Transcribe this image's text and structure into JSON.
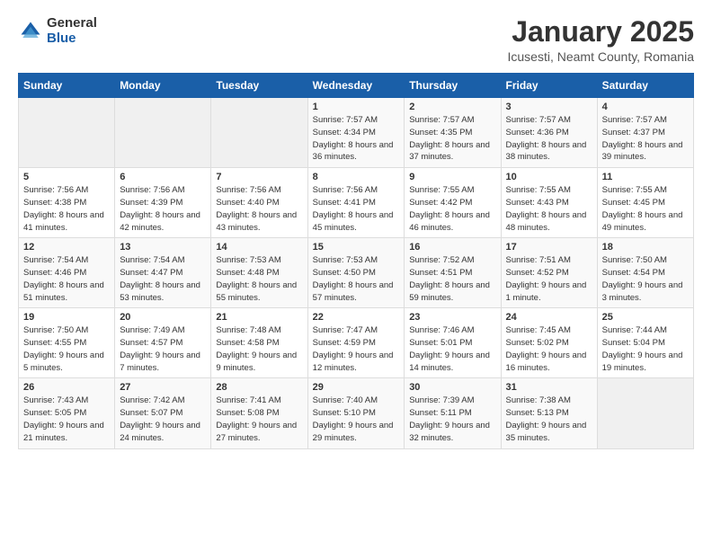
{
  "logo": {
    "general": "General",
    "blue": "Blue"
  },
  "title": "January 2025",
  "location": "Icusesti, Neamt County, Romania",
  "weekdays": [
    "Sunday",
    "Monday",
    "Tuesday",
    "Wednesday",
    "Thursday",
    "Friday",
    "Saturday"
  ],
  "weeks": [
    [
      {
        "day": "",
        "info": ""
      },
      {
        "day": "",
        "info": ""
      },
      {
        "day": "",
        "info": ""
      },
      {
        "day": "1",
        "info": "Sunrise: 7:57 AM\nSunset: 4:34 PM\nDaylight: 8 hours and 36 minutes."
      },
      {
        "day": "2",
        "info": "Sunrise: 7:57 AM\nSunset: 4:35 PM\nDaylight: 8 hours and 37 minutes."
      },
      {
        "day": "3",
        "info": "Sunrise: 7:57 AM\nSunset: 4:36 PM\nDaylight: 8 hours and 38 minutes."
      },
      {
        "day": "4",
        "info": "Sunrise: 7:57 AM\nSunset: 4:37 PM\nDaylight: 8 hours and 39 minutes."
      }
    ],
    [
      {
        "day": "5",
        "info": "Sunrise: 7:56 AM\nSunset: 4:38 PM\nDaylight: 8 hours and 41 minutes."
      },
      {
        "day": "6",
        "info": "Sunrise: 7:56 AM\nSunset: 4:39 PM\nDaylight: 8 hours and 42 minutes."
      },
      {
        "day": "7",
        "info": "Sunrise: 7:56 AM\nSunset: 4:40 PM\nDaylight: 8 hours and 43 minutes."
      },
      {
        "day": "8",
        "info": "Sunrise: 7:56 AM\nSunset: 4:41 PM\nDaylight: 8 hours and 45 minutes."
      },
      {
        "day": "9",
        "info": "Sunrise: 7:55 AM\nSunset: 4:42 PM\nDaylight: 8 hours and 46 minutes."
      },
      {
        "day": "10",
        "info": "Sunrise: 7:55 AM\nSunset: 4:43 PM\nDaylight: 8 hours and 48 minutes."
      },
      {
        "day": "11",
        "info": "Sunrise: 7:55 AM\nSunset: 4:45 PM\nDaylight: 8 hours and 49 minutes."
      }
    ],
    [
      {
        "day": "12",
        "info": "Sunrise: 7:54 AM\nSunset: 4:46 PM\nDaylight: 8 hours and 51 minutes."
      },
      {
        "day": "13",
        "info": "Sunrise: 7:54 AM\nSunset: 4:47 PM\nDaylight: 8 hours and 53 minutes."
      },
      {
        "day": "14",
        "info": "Sunrise: 7:53 AM\nSunset: 4:48 PM\nDaylight: 8 hours and 55 minutes."
      },
      {
        "day": "15",
        "info": "Sunrise: 7:53 AM\nSunset: 4:50 PM\nDaylight: 8 hours and 57 minutes."
      },
      {
        "day": "16",
        "info": "Sunrise: 7:52 AM\nSunset: 4:51 PM\nDaylight: 8 hours and 59 minutes."
      },
      {
        "day": "17",
        "info": "Sunrise: 7:51 AM\nSunset: 4:52 PM\nDaylight: 9 hours and 1 minute."
      },
      {
        "day": "18",
        "info": "Sunrise: 7:50 AM\nSunset: 4:54 PM\nDaylight: 9 hours and 3 minutes."
      }
    ],
    [
      {
        "day": "19",
        "info": "Sunrise: 7:50 AM\nSunset: 4:55 PM\nDaylight: 9 hours and 5 minutes."
      },
      {
        "day": "20",
        "info": "Sunrise: 7:49 AM\nSunset: 4:57 PM\nDaylight: 9 hours and 7 minutes."
      },
      {
        "day": "21",
        "info": "Sunrise: 7:48 AM\nSunset: 4:58 PM\nDaylight: 9 hours and 9 minutes."
      },
      {
        "day": "22",
        "info": "Sunrise: 7:47 AM\nSunset: 4:59 PM\nDaylight: 9 hours and 12 minutes."
      },
      {
        "day": "23",
        "info": "Sunrise: 7:46 AM\nSunset: 5:01 PM\nDaylight: 9 hours and 14 minutes."
      },
      {
        "day": "24",
        "info": "Sunrise: 7:45 AM\nSunset: 5:02 PM\nDaylight: 9 hours and 16 minutes."
      },
      {
        "day": "25",
        "info": "Sunrise: 7:44 AM\nSunset: 5:04 PM\nDaylight: 9 hours and 19 minutes."
      }
    ],
    [
      {
        "day": "26",
        "info": "Sunrise: 7:43 AM\nSunset: 5:05 PM\nDaylight: 9 hours and 21 minutes."
      },
      {
        "day": "27",
        "info": "Sunrise: 7:42 AM\nSunset: 5:07 PM\nDaylight: 9 hours and 24 minutes."
      },
      {
        "day": "28",
        "info": "Sunrise: 7:41 AM\nSunset: 5:08 PM\nDaylight: 9 hours and 27 minutes."
      },
      {
        "day": "29",
        "info": "Sunrise: 7:40 AM\nSunset: 5:10 PM\nDaylight: 9 hours and 29 minutes."
      },
      {
        "day": "30",
        "info": "Sunrise: 7:39 AM\nSunset: 5:11 PM\nDaylight: 9 hours and 32 minutes."
      },
      {
        "day": "31",
        "info": "Sunrise: 7:38 AM\nSunset: 5:13 PM\nDaylight: 9 hours and 35 minutes."
      },
      {
        "day": "",
        "info": ""
      }
    ]
  ]
}
